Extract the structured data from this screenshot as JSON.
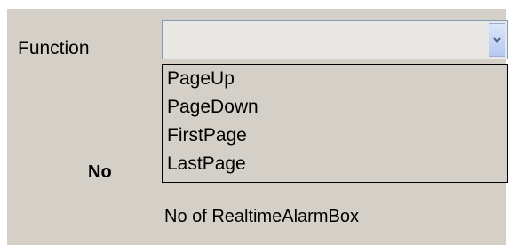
{
  "form": {
    "function_label": "Function",
    "no_label": "No",
    "no_of_text": "No of RealtimeAlarmBox"
  },
  "function_select": {
    "selected_value": "",
    "arrow_icon": "chevron-down-icon",
    "options": [
      {
        "label": "PageUp"
      },
      {
        "label": "PageDown"
      },
      {
        "label": "FirstPage"
      },
      {
        "label": "LastPage"
      }
    ]
  },
  "colors": {
    "panel_background": "#d4d0c8",
    "combo_border": "#7f9db9",
    "arrow_gradient_top": "#dbe6fb",
    "arrow_gradient_bottom": "#b5c8f1"
  }
}
